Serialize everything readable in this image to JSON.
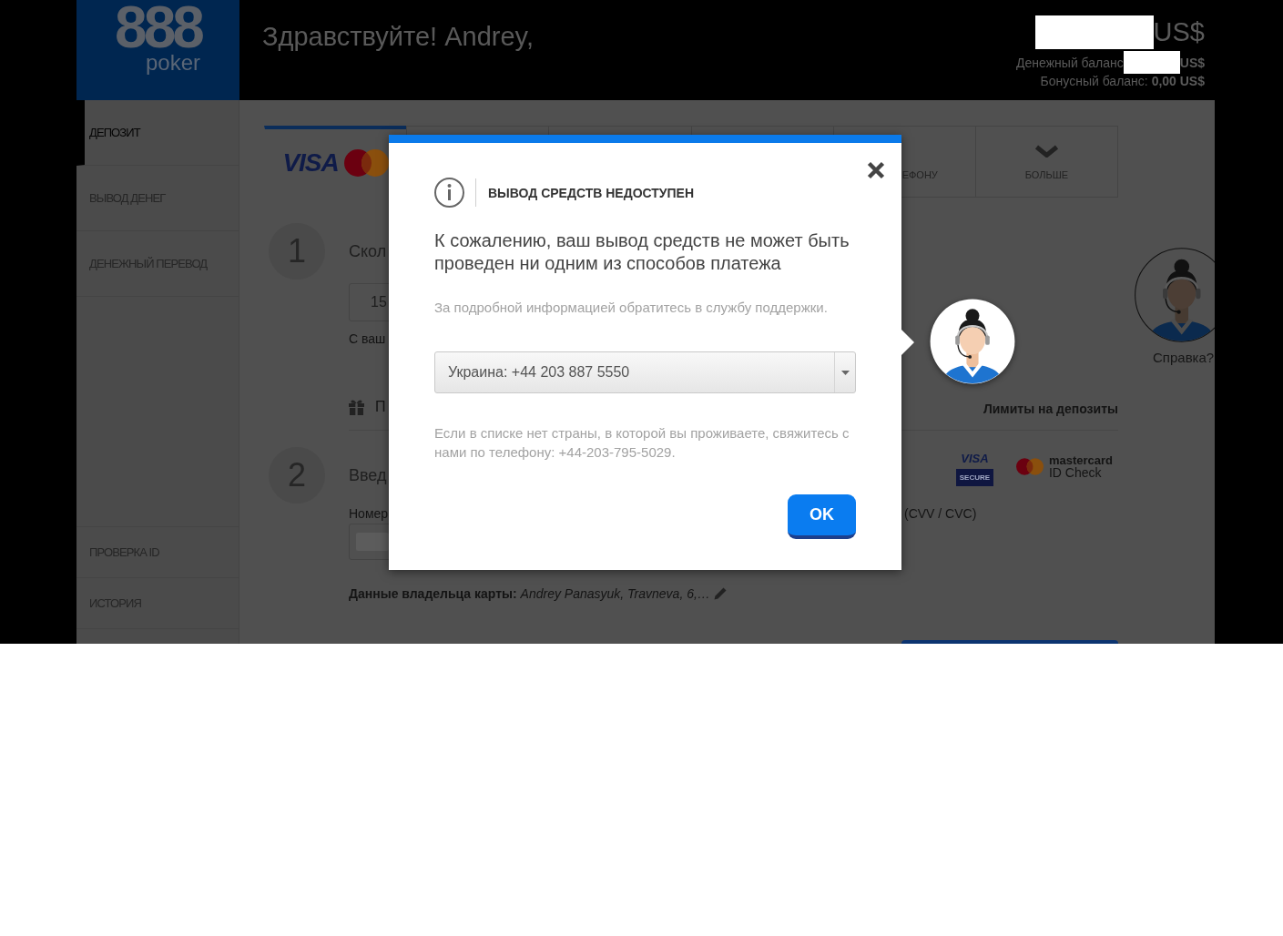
{
  "header": {
    "logo": {
      "mark": "888",
      "wordmark": "poker"
    },
    "greeting": "Здравствуйте! Andrey,",
    "total": {
      "redacted": true,
      "currency": "US$"
    },
    "cash_balance": {
      "label": "Денежный баланс",
      "redacted": true,
      "currency": "US$"
    },
    "bonus_balance": "Бонусный баланс: **0,00 US$**"
  },
  "sidebar": {
    "items": [
      {
        "label": "ДЕПОЗИТ",
        "selected": true
      },
      {
        "label": "ВЫВОД ДЕНЕГ",
        "selected": false
      },
      {
        "label": "ДЕНЕЖНЫЙ ПЕРЕВОД",
        "selected": false
      }
    ],
    "bottom_items": [
      {
        "label": "ПРОВЕРКА ID",
        "selected": false
      },
      {
        "label": "ИСТОРИЯ",
        "selected": false
      }
    ]
  },
  "payment_tabs": [
    {
      "kind": "cards",
      "logo": "VISA",
      "selected": true
    },
    {
      "kind": "covered",
      "selected": false
    },
    {
      "kind": "covered",
      "selected": false
    },
    {
      "kind": "covered",
      "selected": false
    },
    {
      "kind": "phone",
      "label": "ЕФОНУ",
      "selected": false
    },
    {
      "kind": "more",
      "label": "БОЛЬШЕ",
      "selected": false
    }
  ],
  "deposit_form": {
    "step_1": {
      "number": "1",
      "title": "Скол",
      "amount": "15",
      "hint": "С ваш",
      "promo": "П",
      "limits_link": "Лимиты на депозиты"
    },
    "step_2": {
      "number": "2",
      "title": "Введ",
      "card_label": "Номер",
      "cvv_label": "(CVV / CVC)",
      "security_logos": [
        {
          "kind": "visa_secure",
          "top": "VISA",
          "bottom": "SECURE"
        },
        {
          "kind": "mastercard_id",
          "top": "mastercard",
          "bottom": "ID Check"
        }
      ]
    },
    "card_holder": "**Данные владельца карты:** *Andrey Panasyuk, Travneva, 6,…*"
  },
  "help": {
    "label": "Справка?"
  },
  "modal": {
    "title": "ВЫВОД СРЕДСТВ НЕДОСТУПЕН",
    "message": "К сожалению, ваш вывод средств не может быть проведен ни одним из способов платежа",
    "support_note": "За подробной информацией обратитесь в службу поддержки.",
    "country_select": {
      "value": "Украина: +44 203 887 5550"
    },
    "footer_note": "Если в списке нет страны, в которой вы проживаете, свяжитесь с нами по телефону: +44-203-795-5029.",
    "ok_button": "OK"
  }
}
